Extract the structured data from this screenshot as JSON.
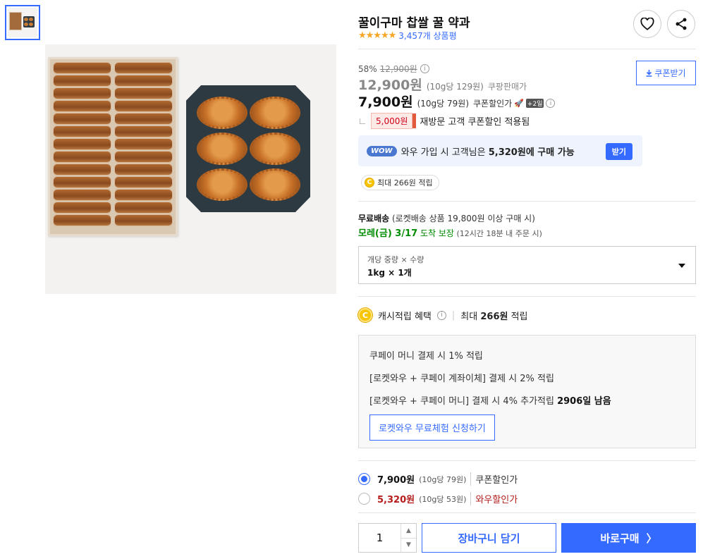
{
  "gallery": {
    "thumbnail_alt": "thumbnail"
  },
  "product": {
    "title": "꿀이구마 찹쌀 꿀 약과",
    "stars": "★★★★★",
    "review_count": "3,457개 상품평"
  },
  "pricing": {
    "discount_rate": "58%",
    "original_price": "12,900원",
    "price1": "12,900원",
    "price1_unit": "(10g당 129원)",
    "price1_label": "쿠팡판매가",
    "price2": "7,900원",
    "price2_unit": "(10g당 79원)",
    "price2_label": "쿠폰할인가",
    "plus_badge": "+2일",
    "coupon_button": "쿠폰받기",
    "revisit_amount": "5,000원",
    "revisit_text": "재방문 고객 쿠폰할인 적용됨"
  },
  "wow": {
    "badge": "WOW",
    "text_prefix": "와우 가입 시 고객님은 ",
    "text_bold": "5,320원에 구매 가능",
    "button": "받기"
  },
  "cash_pill": {
    "coin": "C",
    "text": "최대 266원 적립"
  },
  "shipping": {
    "free_label": "무료배송",
    "free_detail": " (로켓배송 상품 19,800원 이상 구매 시)",
    "arrival_date": "모레(금) 3/17",
    "arrival_label": " 도착 보장",
    "arrival_note": " (12시간 18분 내 주문 시)"
  },
  "option": {
    "label": "개당 중량 × 수량",
    "value": "1kg × 1개"
  },
  "cash_benefit": {
    "coin": "C",
    "label": "캐시적립 혜택",
    "separator": "|",
    "prefix": "최대 ",
    "amount": "266원",
    "suffix": " 적립"
  },
  "benefit_box": {
    "line1": "쿠페이 머니 결제 시 1% 적립",
    "line2": "[로켓와우 + 쿠페이 계좌이체] 결제 시 2% 적립",
    "line3": "[로켓와우 + 쿠페이 머니] 결제 시 4% 추가적립 ",
    "line3_bold": "2906일 남음",
    "trial_button": "로켓와우 무료체험 신청하기"
  },
  "price_options": [
    {
      "price": "7,900원",
      "unit": "(10g당 79원)",
      "label": "쿠폰할인가",
      "selected": true
    },
    {
      "price": "5,320원",
      "unit": "(10g당 53원)",
      "label": "와우할인가",
      "selected": false
    }
  ],
  "purchase": {
    "quantity": "1",
    "cart_button": "장바구니 담기",
    "buy_button": "바로구매",
    "buy_arrow": "〉"
  },
  "colors": {
    "accent": "#346aff",
    "star": "#f5a623",
    "wow_price": "#b51c1c",
    "arrival_green": "#008c00"
  }
}
